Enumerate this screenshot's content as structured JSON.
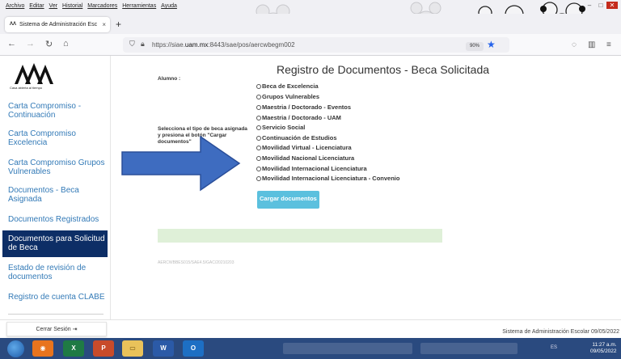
{
  "browser": {
    "menu": [
      "Archivo",
      "Editar",
      "Ver",
      "Historial",
      "Marcadores",
      "Herramientas",
      "Ayuda"
    ],
    "tab_title": "Sistema de Administración Esc",
    "tab_close": "×",
    "new_tab": "+",
    "url_prefix": "https://siae.",
    "url_domain": "uam.mx",
    "url_suffix": ":8443/sae/pos/aercwbegm002",
    "zoom": "90%"
  },
  "sidebar": {
    "logo_caption": "Casa abierta al tiempo",
    "items": [
      "Carta Compromiso - Continuación",
      "Carta Compromiso Excelencia",
      "Carta Compromiso Grupos Vulnerables",
      "Documentos - Beca Asignada",
      "Documentos Registrados",
      "Documentos para Solicitud de Beca",
      "Estado de revisión de documentos",
      "Registro de cuenta CLABE"
    ],
    "active_index": 5,
    "logout_label": "Cerrar Sesión"
  },
  "main": {
    "title": "Registro de Documentos - Beca Solicitada",
    "student_label": "Alumno :",
    "instructions": "Selecciona el tipo de beca asignada y presiona el botón \"Cargar documentos\"",
    "options": [
      "Beca de Excelencia",
      "Grupos Vulnerables",
      "Maestria / Doctorado - Eventos",
      "Maestria / Doctorado - UAM",
      "Servicio Social",
      "Continuación de Estudios",
      "Movilidad Virtual - Licenciatura",
      "Movilidad Nacional Licenciatura",
      "Movilidad Internacional Licenciatura",
      "Movilidad Internacional Licenciatura - Convenio"
    ],
    "upload_button": "Cargar documentos",
    "page_code": "AERCWBBES015/SAE4.5/GAC/20210203"
  },
  "footer": {
    "text": "Sistema de Administración Escolar 09/05/2022"
  },
  "taskbar": {
    "language": "ES",
    "time": "11:27 a.m.",
    "date": "09/05/2022"
  },
  "colors": {
    "link": "#337ab7",
    "active_bg": "#0d2e66",
    "button": "#5bc0de",
    "alert": "#dff0d8",
    "arrow": "#3e6cc0",
    "taskbar": "#2a4a7f"
  }
}
